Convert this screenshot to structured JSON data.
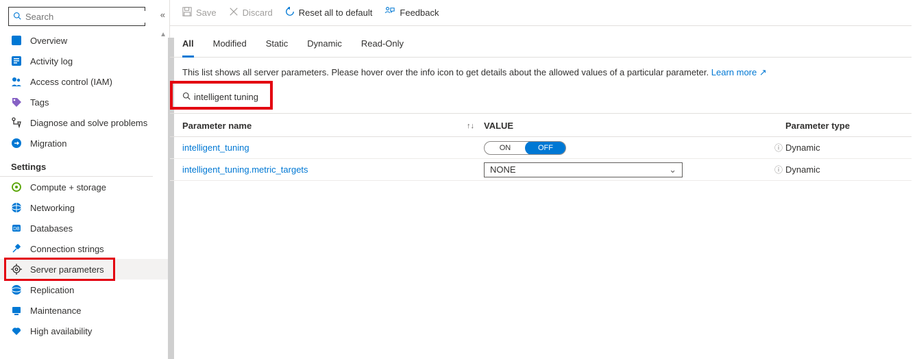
{
  "sidebar": {
    "search_placeholder": "Search",
    "items1": [
      {
        "icon": "overview",
        "label": "Overview"
      },
      {
        "icon": "activity",
        "label": "Activity log"
      },
      {
        "icon": "iam",
        "label": "Access control (IAM)"
      },
      {
        "icon": "tags",
        "label": "Tags"
      },
      {
        "icon": "diagnose",
        "label": "Diagnose and solve problems"
      },
      {
        "icon": "migration",
        "label": "Migration"
      }
    ],
    "group_label": "Settings",
    "items2": [
      {
        "icon": "compute",
        "label": "Compute + storage"
      },
      {
        "icon": "network",
        "label": "Networking"
      },
      {
        "icon": "db",
        "label": "Databases"
      },
      {
        "icon": "conn",
        "label": "Connection strings"
      },
      {
        "icon": "params",
        "label": "Server parameters",
        "selected": true
      },
      {
        "icon": "repl",
        "label": "Replication"
      },
      {
        "icon": "maint",
        "label": "Maintenance"
      },
      {
        "icon": "ha",
        "label": "High availability"
      }
    ]
  },
  "toolbar": {
    "save": "Save",
    "discard": "Discard",
    "reset": "Reset all to default",
    "feedback": "Feedback"
  },
  "tabs": [
    "All",
    "Modified",
    "Static",
    "Dynamic",
    "Read-Only"
  ],
  "active_tab": 0,
  "description": "This list shows all server parameters. Please hover over the info icon to get details about the allowed values of a particular parameter.",
  "learn_more": "Learn more",
  "filter_value": "intelligent tuning",
  "columns": {
    "name": "Parameter name",
    "value": "VALUE",
    "type": "Parameter type"
  },
  "rows": [
    {
      "name": "intelligent_tuning",
      "value_kind": "toggle",
      "value": "OFF",
      "on": "ON",
      "off": "OFF",
      "type": "Dynamic"
    },
    {
      "name": "intelligent_tuning.metric_targets",
      "value_kind": "select",
      "value": "NONE",
      "type": "Dynamic"
    }
  ]
}
